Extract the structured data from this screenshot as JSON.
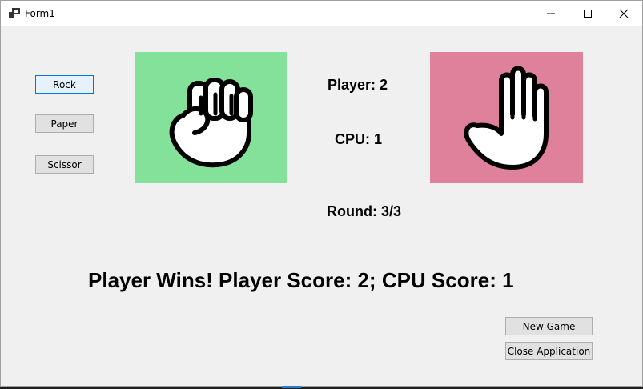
{
  "window": {
    "title": "Form1",
    "icons": {
      "app": "form-app-icon",
      "minimize": "minimize-icon",
      "maximize": "maximize-icon",
      "close": "close-icon"
    }
  },
  "choices": {
    "rock_label": "Rock",
    "paper_label": "Paper",
    "scissor_label": "Scissor"
  },
  "player_panel": {
    "icon": "fist-rock-icon",
    "color": "#84e19a"
  },
  "cpu_panel": {
    "icon": "open-hand-paper-icon",
    "color": "#e0819c"
  },
  "score": {
    "player_text": "Player: 2",
    "cpu_text": "CPU: 1",
    "round_text": "Round: 3/3"
  },
  "result_text": "Player Wins! Player Score: 2; CPU Score: 1",
  "actions": {
    "new_game_label": "New Game",
    "close_label": "Close Application"
  }
}
